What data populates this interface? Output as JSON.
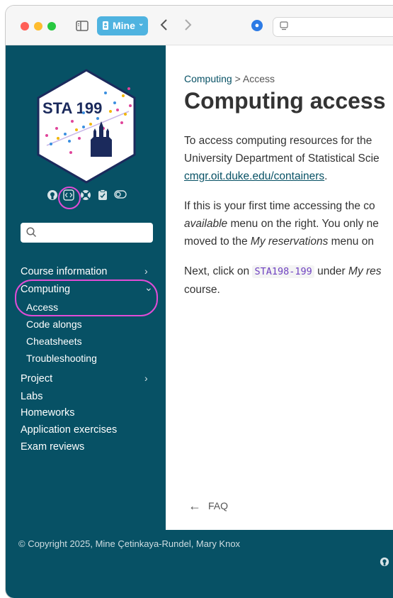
{
  "browser": {
    "profile_label": "Mine"
  },
  "sidebar": {
    "logo_text": "STA 199",
    "search_placeholder": "",
    "nav": {
      "course_information": "Course information",
      "computing": "Computing",
      "computing_sub": [
        "Access",
        "Code alongs",
        "Cheatsheets",
        "Troubleshooting"
      ],
      "project": "Project",
      "labs": "Labs",
      "homeworks": "Homeworks",
      "application_exercises": "Application exercises",
      "exam_reviews": "Exam reviews"
    }
  },
  "main": {
    "breadcrumb_parent": "Computing",
    "breadcrumb_sep": ">",
    "breadcrumb_current": "Access",
    "title": "Computing access",
    "p1": {
      "line1": "To access computing resources for the",
      "line2": "University Department of Statistical Scie",
      "link": "cmgr.oit.duke.edu/containers",
      "after_link": "."
    },
    "p2": {
      "line1": "If this is your first time accessing the co",
      "line2_em": "available",
      "line2_rest": " menu on the right. You only ne",
      "line3_pre": "moved to the ",
      "line3_em": "My reservations",
      "line3_rest": " menu on"
    },
    "p3": {
      "pre": "Next, click on ",
      "code": "STA198-199",
      "mid": " under ",
      "em": "My res",
      "line2": "course."
    },
    "prev_link": "FAQ"
  },
  "footer": {
    "copyright": "© Copyright 2025, Mine Çetinkaya-Rundel, Mary Knox"
  },
  "colors": {
    "sidebar_bg": "#075165",
    "annotation": "#e14cd6",
    "code": "#6f42c1"
  }
}
